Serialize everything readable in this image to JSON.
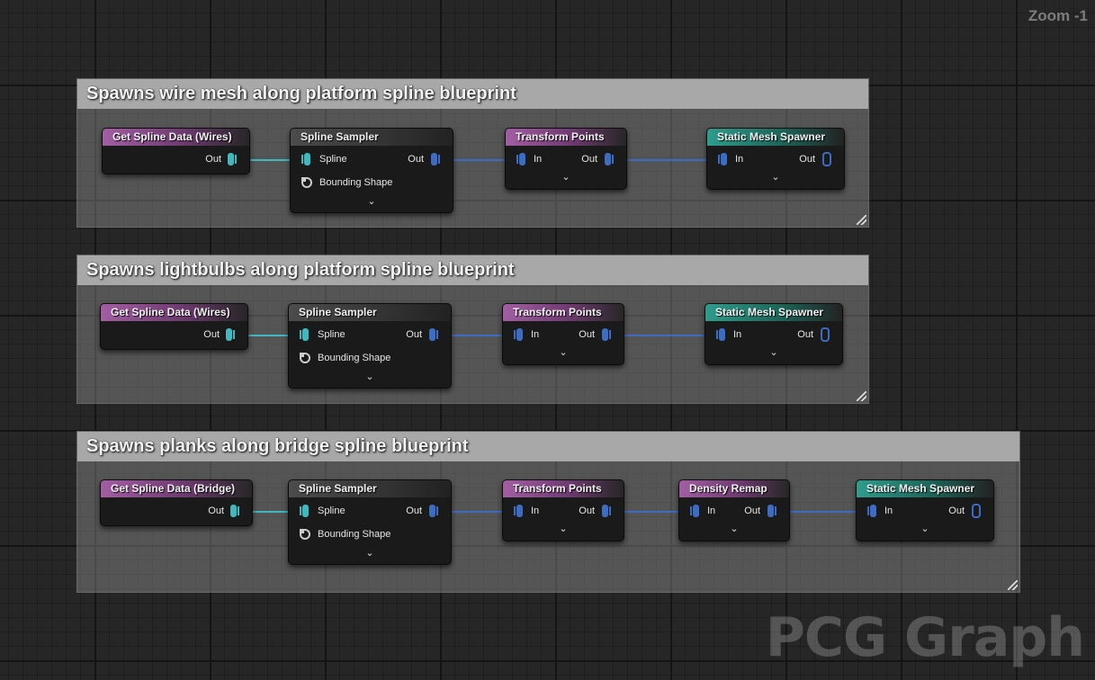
{
  "zoom_label": "Zoom -1",
  "watermark": "PCG Graph",
  "icons": {
    "pin": "data-pin-icon",
    "bounding_shape": "bounding-shape-pin-icon",
    "expand": "chevron-down-icon",
    "resize": "resize-handle-icon"
  },
  "colors": {
    "purple_header": "#a35ea3",
    "teal_header": "#2f9c8c",
    "spline_wire": "#3fb8c0",
    "point_wire": "#3d6cc4"
  },
  "comments": [
    {
      "title": "Spawns wire mesh along platform spline blueprint",
      "nodes": {
        "get_spline": {
          "title": "Get Spline Data (Wires)",
          "out": "Out"
        },
        "sampler": {
          "title": "Spline Sampler",
          "in": "Spline",
          "out": "Out",
          "shape": "Bounding Shape"
        },
        "transform": {
          "title": "Transform Points",
          "in": "In",
          "out": "Out"
        },
        "spawner": {
          "title": "Static Mesh Spawner",
          "in": "In",
          "out": "Out"
        }
      }
    },
    {
      "title": "Spawns lightbulbs along platform spline blueprint",
      "nodes": {
        "get_spline": {
          "title": "Get Spline Data (Wires)",
          "out": "Out"
        },
        "sampler": {
          "title": "Spline Sampler",
          "in": "Spline",
          "out": "Out",
          "shape": "Bounding Shape"
        },
        "transform": {
          "title": "Transform Points",
          "in": "In",
          "out": "Out"
        },
        "spawner": {
          "title": "Static Mesh Spawner",
          "in": "In",
          "out": "Out"
        }
      }
    },
    {
      "title": "Spawns planks along bridge spline blueprint",
      "nodes": {
        "get_spline": {
          "title": "Get Spline Data (Bridge)",
          "out": "Out"
        },
        "sampler": {
          "title": "Spline Sampler",
          "in": "Spline",
          "out": "Out",
          "shape": "Bounding Shape"
        },
        "transform": {
          "title": "Transform Points",
          "in": "In",
          "out": "Out"
        },
        "density": {
          "title": "Density Remap",
          "in": "In",
          "out": "Out"
        },
        "spawner": {
          "title": "Static Mesh Spawner",
          "in": "In",
          "out": "Out"
        }
      }
    }
  ]
}
